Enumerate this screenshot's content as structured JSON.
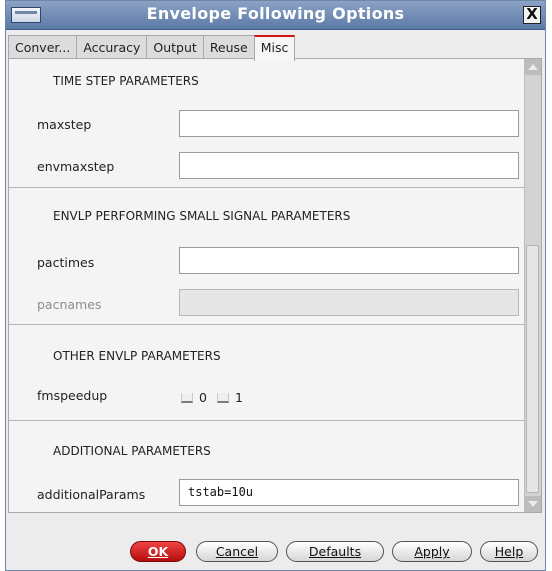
{
  "window": {
    "title": "Envelope Following Options",
    "close_label": "X"
  },
  "tabs": [
    {
      "label": "Conver..."
    },
    {
      "label": "Accuracy"
    },
    {
      "label": "Output"
    },
    {
      "label": "Reuse"
    },
    {
      "label": "Misc",
      "active": true
    }
  ],
  "sections": {
    "time_step": {
      "heading": "TIME STEP PARAMETERS",
      "maxstep": {
        "label": "maxstep",
        "value": ""
      },
      "envmaxstep": {
        "label": "envmaxstep",
        "value": ""
      }
    },
    "small_signal": {
      "heading": "ENVLP PERFORMING SMALL SIGNAL PARAMETERS",
      "pactimes": {
        "label": "pactimes",
        "value": ""
      },
      "pacnames": {
        "label": "pacnames",
        "value": "",
        "disabled": true
      }
    },
    "other": {
      "heading": "OTHER ENVLP PARAMETERS",
      "fmspeedup": {
        "label": "fmspeedup",
        "options": [
          "0",
          "1"
        ]
      }
    },
    "additional": {
      "heading": "ADDITIONAL PARAMETERS",
      "additionalParams": {
        "label": "additionalParams",
        "value": "tstab=10u"
      }
    }
  },
  "buttons": {
    "ok": "OK",
    "cancel": "Cancel",
    "defaults": "Defaults",
    "apply": "Apply",
    "help": "Help"
  },
  "colors": {
    "titlebar": "#6d88b3",
    "ok_button": "#d21414",
    "active_tab_accent": "#d21414"
  }
}
